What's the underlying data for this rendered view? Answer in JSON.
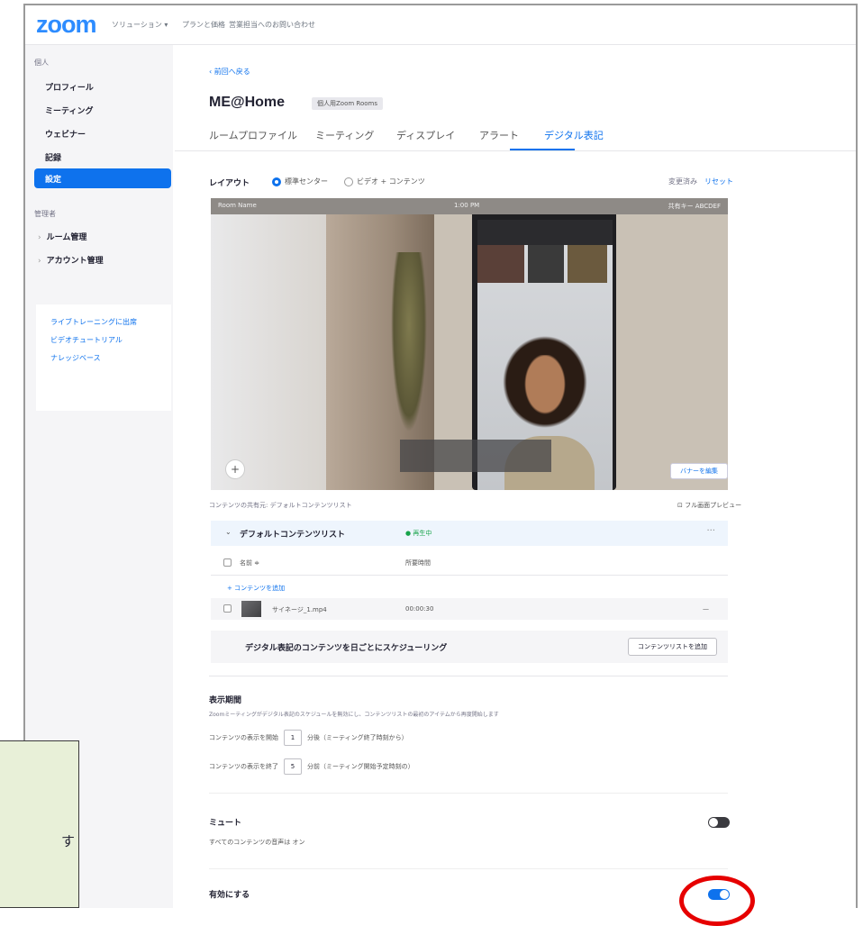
{
  "nav": {
    "logo": "zoom",
    "links": [
      "ソリューション ▾",
      "プランと価格",
      "営業担当へのお問い合わせ"
    ]
  },
  "sidebar": {
    "personal_header": "個人",
    "items": [
      "プロフィール",
      "ミーティング",
      "ウェビナー",
      "記録",
      "設定"
    ],
    "admin_header": "管理者",
    "admin_items": [
      "ルーム管理",
      "アカウント管理"
    ],
    "links": [
      "ライブトレーニングに出席",
      "ビデオチュートリアル",
      "ナレッジベース"
    ]
  },
  "main": {
    "back_link": "‹ 前回へ戻る",
    "room_title": "ME@Home",
    "room_badge": "個人用Zoom Rooms",
    "tabs": [
      "ルームプロファイル",
      "ミーティング",
      "ディスプレイ",
      "アラート",
      "デジタル表記"
    ],
    "active_tab": "デジタル表記",
    "layout_label": "レイアウト",
    "layout_options": [
      "標準センター",
      "ビデオ + コンテンツ"
    ],
    "changed_label": "変更済み",
    "reset_label": "リセット",
    "preview": {
      "room_name": "Room Name",
      "time": "1:00 PM",
      "meeting_meta": "共有キー ABCDEF",
      "plus": "+",
      "edit_banner": "バナーを編集"
    },
    "content_source": "コンテンツの共有元: デフォルトコンテンツリスト",
    "fullscreen_preview": "⊡ フル画面プレビュー",
    "content_list": {
      "name": "デフォルトコンテンツリスト",
      "status": "● 再生中",
      "more": "···",
      "col_name": "名前 ≑",
      "col_duration": "所要時間",
      "add_content": "+ コンテンツを追加",
      "file_name": "サイネージ_1.mp4",
      "file_duration": "00:00:30",
      "file_more": "—",
      "schedule_text": "デジタル表記のコンテンツを日ごとにスケジューリング",
      "add_list_button": "コンテンツリストを追加"
    },
    "period": {
      "title": "表示期間",
      "description": "Zoomミーティングがデジタル表記のスケジュールを無効にし、コンテンツリストの最初のアイテムから再度開始します",
      "start_prefix": "コンテンツの表示を開始",
      "start_value": "1",
      "start_suffix": "分後（ミーティング終了時刻から）",
      "end_prefix": "コンテンツの表示を終了",
      "end_value": "5",
      "end_suffix": "分前（ミーティング開始予定時刻の）"
    },
    "mute": {
      "title": "ミュート",
      "description": "すべてのコンテンツの音声は オン",
      "state": "off"
    },
    "enable": {
      "title": "有効にする",
      "state": "on"
    }
  },
  "callout": {
    "text": "す"
  },
  "colors": {
    "accent": "#0e72ed",
    "highlight_ring": "#e60000",
    "callout_bg": "#e8f0d8"
  }
}
